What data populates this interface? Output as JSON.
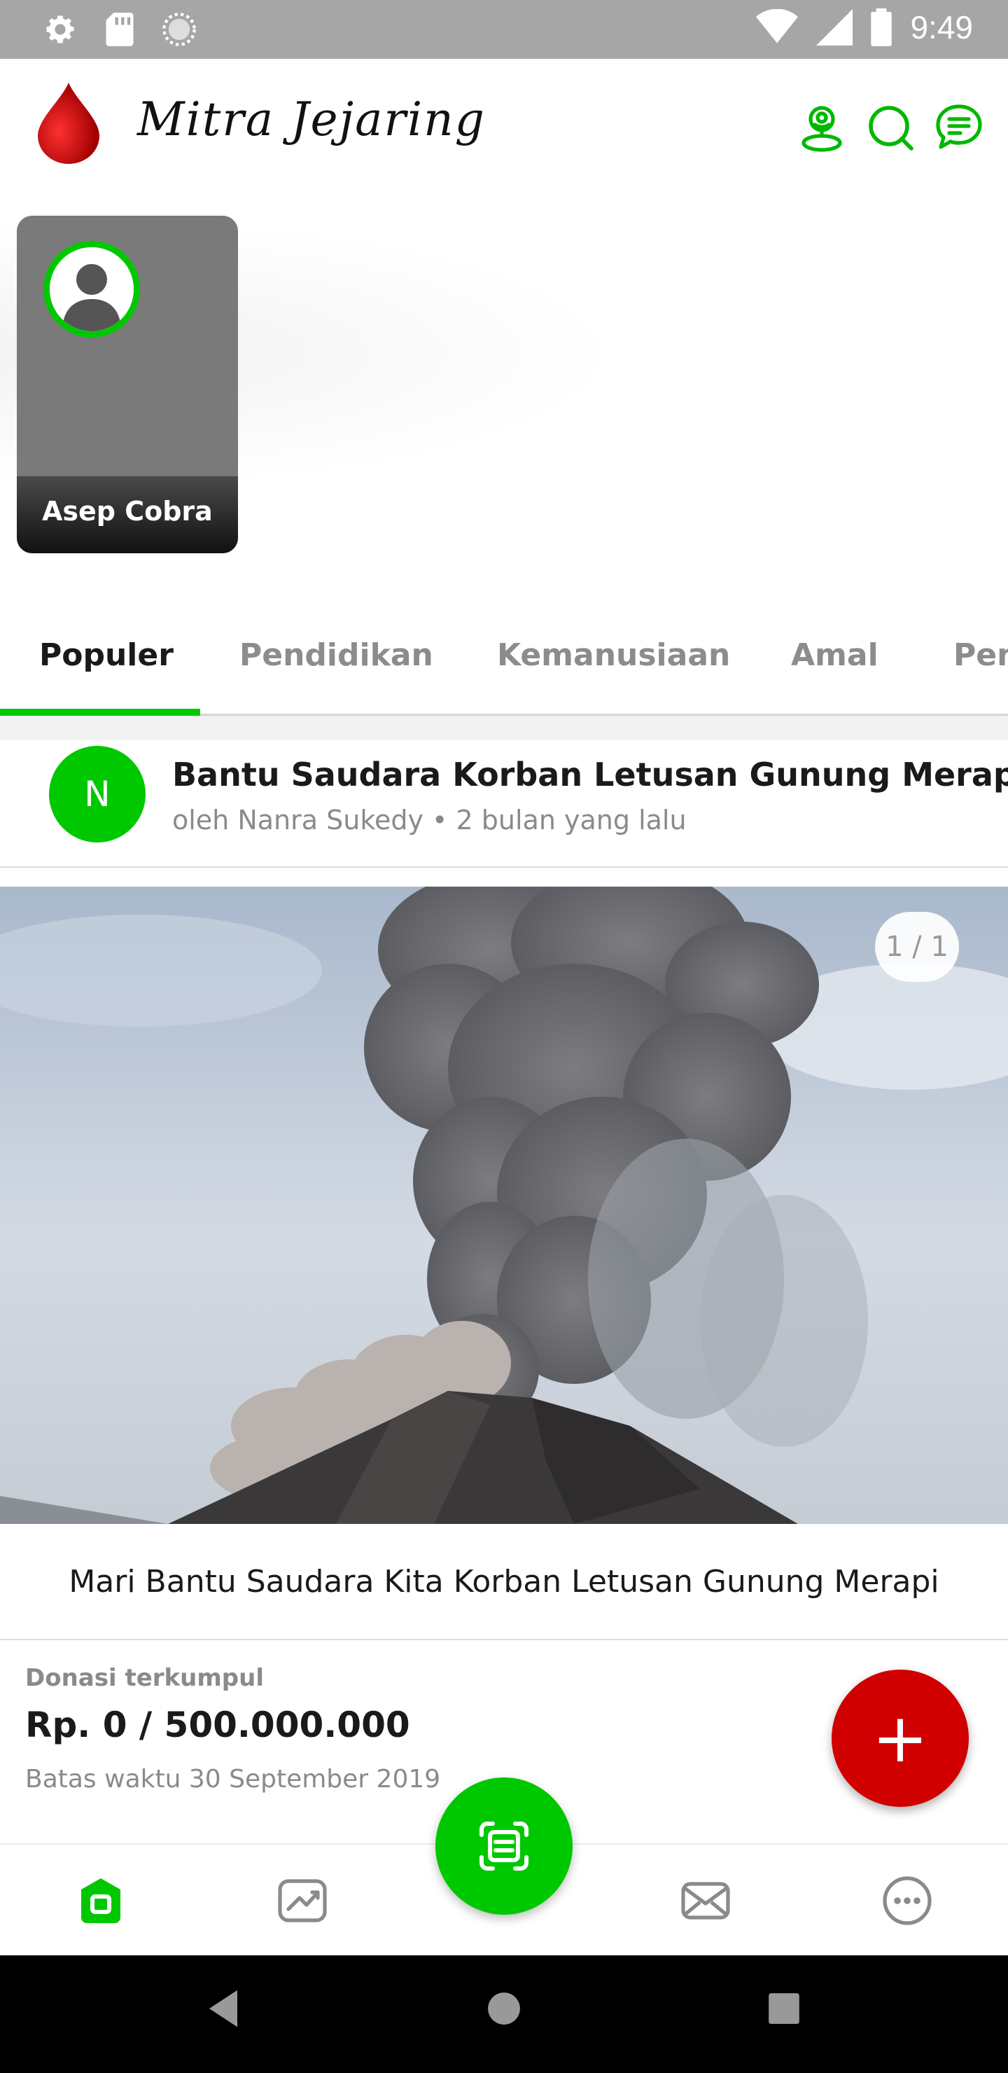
{
  "status_bar": {
    "time": "9:49",
    "icons": [
      "settings-icon",
      "sd-card-icon",
      "sync-icon",
      "wifi-icon",
      "signal-icon",
      "battery-icon"
    ]
  },
  "header": {
    "app_title": "Mitra Jejaring",
    "icons": [
      "location-person-icon",
      "search-icon",
      "chat-icon"
    ],
    "brand_color": "#00C800",
    "logo_color": "#CC0000"
  },
  "stories": [
    {
      "name": "Asep Cobra"
    }
  ],
  "tabs": [
    {
      "label": "Populer",
      "active": true
    },
    {
      "label": "Pendidikan",
      "active": false
    },
    {
      "label": "Kemanusiaan",
      "active": false
    },
    {
      "label": "Amal",
      "active": false
    },
    {
      "label": "Pen",
      "active": false
    }
  ],
  "post": {
    "avatar_initial": "N",
    "title": "Bantu Saudara Korban Letusan Gunung Merapi",
    "meta": "oleh Nanra Sukedy • 2 bulan yang lalu",
    "image_counter": "1 / 1",
    "caption": "Mari Bantu Saudara Kita Korban Letusan Gunung Merapi"
  },
  "donation": {
    "label": "Donasi terkumpul",
    "amount": "Rp. 0 / 500.000.000",
    "deadline": "Batas waktu 30 September 2019"
  },
  "fab_add": {
    "label": "+"
  },
  "bottom_nav": {
    "items": [
      "home-icon",
      "trending-icon",
      "scan-icon",
      "mail-icon",
      "more-icon"
    ],
    "active": "home-icon"
  },
  "system_nav": [
    "back-icon",
    "home-circle-icon",
    "recents-icon"
  ]
}
